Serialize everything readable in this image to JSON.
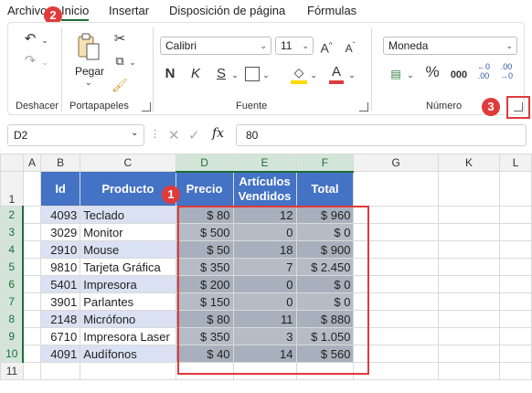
{
  "menu": {
    "tabs": [
      {
        "label": "Archivo"
      },
      {
        "label": "Inicio"
      },
      {
        "label": "Insertar"
      },
      {
        "label": "Disposición de página"
      },
      {
        "label": "Fórmulas"
      }
    ]
  },
  "ribbon": {
    "groups": {
      "undo": "Deshacer",
      "clipboard": "Portapapeles",
      "font": "Fuente",
      "number": "Número"
    },
    "paste_label": "Pegar",
    "font_name": "Calibri",
    "font_size": "11",
    "number_format": "Moneda",
    "bold": "N",
    "italic": "K",
    "underline": "S",
    "percent": "%",
    "thousands": "000"
  },
  "callouts": {
    "one": "1",
    "two": "2",
    "three": "3"
  },
  "formula_bar": {
    "name_box": "D2",
    "fx": "fx",
    "value": "80"
  },
  "sheet": {
    "columns": [
      "A",
      "B",
      "C",
      "D",
      "E",
      "F",
      "G",
      "K",
      "L"
    ],
    "rows": [
      "1",
      "2",
      "3",
      "4",
      "5",
      "6",
      "7",
      "8",
      "9",
      "10",
      "11"
    ],
    "headers": {
      "id": "Id",
      "product": "Producto",
      "price": "Precio",
      "units_line1": "Artículos",
      "units_line2": "Vendidos",
      "total": "Total"
    },
    "data": [
      {
        "id": "4093",
        "product": "Teclado",
        "price": "$ 80",
        "units": "12",
        "total": "$ 960"
      },
      {
        "id": "3029",
        "product": "Monitor",
        "price": "$ 500",
        "units": "0",
        "total": "$ 0"
      },
      {
        "id": "2910",
        "product": "Mouse",
        "price": "$ 50",
        "units": "18",
        "total": "$ 900"
      },
      {
        "id": "9810",
        "product": "Tarjeta Gráfica",
        "price": "$ 350",
        "units": "7",
        "total": "$ 2.450"
      },
      {
        "id": "5401",
        "product": "Impresora",
        "price": "$ 200",
        "units": "0",
        "total": "$ 0"
      },
      {
        "id": "3901",
        "product": "Parlantes",
        "price": "$ 150",
        "units": "0",
        "total": "$ 0"
      },
      {
        "id": "2148",
        "product": "Micrófono",
        "price": "$ 80",
        "units": "11",
        "total": "$ 880"
      },
      {
        "id": "6710",
        "product": "Impresora Laser",
        "price": "$ 350",
        "units": "3",
        "total": "$ 1.050"
      },
      {
        "id": "4091",
        "product": "Audífonos",
        "price": "$ 40",
        "units": "14",
        "total": "$ 560"
      }
    ]
  },
  "colors": {
    "accent": "#1e6e3c",
    "header_fill": "#4472c4",
    "band_fill": "#d9e1f2",
    "callout": "#e03a3a"
  }
}
